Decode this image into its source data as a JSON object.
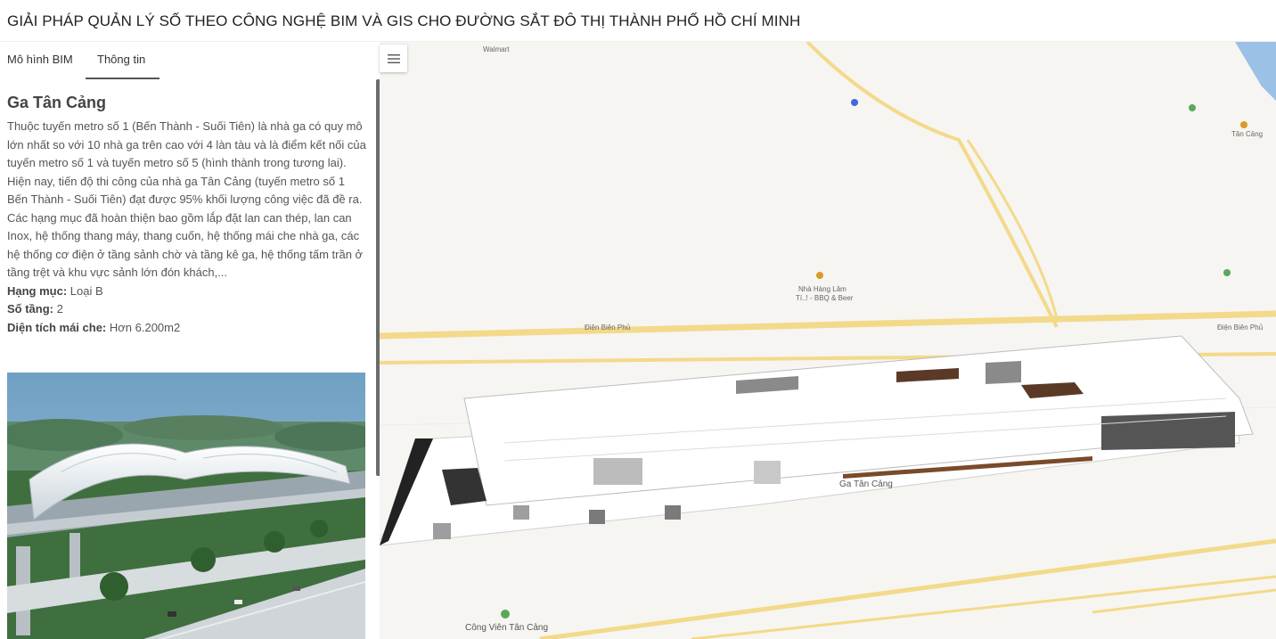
{
  "app": {
    "title": "GIẢI PHÁP QUẢN LÝ SỐ THEO CÔNG NGHỆ BIM VÀ GIS CHO ĐƯỜNG SẮT ĐÔ THỊ THÀNH PHỐ HỒ CHÍ MINH"
  },
  "tabs": [
    {
      "label": "Mô hình BIM",
      "active": false
    },
    {
      "label": "Thông tin",
      "active": true
    }
  ],
  "station": {
    "name": "Ga Tân Cảng",
    "description_1": "Thuộc tuyến metro số 1 (Bến Thành - Suối Tiên) là nhà ga có quy mô lớn nhất so với 10 nhà ga trên cao với 4 làn tàu và là điểm kết nối của tuyến metro số 1 và tuyến metro số 5 (hình thành trong tương lai).",
    "description_2": "Hiện nay, tiến độ thi công của nhà ga Tân Cảng (tuyến metro số 1 Bến Thành - Suối Tiên) đạt được 95% khối lượng công việc đã đề ra.",
    "description_3": "Các hạng mục đã hoàn thiện bao gồm lắp đặt lan can thép, lan can Inox, hệ thống thang máy, thang cuốn, hệ thống mái che nhà ga, các hệ thống cơ điện ở tầng sảnh chờ và tầng kê ga, hệ thống tấm trần ở tầng trệt và khu vực sảnh lớn đón khách,...",
    "category_label": "Hạng mục:",
    "category_value": "Loại B",
    "floors_label": "Số tầng:",
    "floors_value": "2",
    "roof_area_label": "Diện tích mái che:",
    "roof_area_value": "Hơn 6.200m2"
  },
  "map": {
    "menu_icon": "hamburger-menu-icon",
    "labels": {
      "walmart": "Walmart",
      "dien_bien_phu": "Điện Biên Phủ",
      "dien_bien_phu_2": "Điện Biên Phủ",
      "restaurant_line1": "Nhà Hàng Lâm",
      "restaurant_line2": "Tí..! - BBQ & Beer",
      "station": "Ga Tân Cảng",
      "park": "Công Viên Tân Cảng",
      "tan_cang_top": "Tân Cảng"
    }
  },
  "colors": {
    "road": "#f3d98a",
    "map_bg": "#f6f5f1",
    "water": "#9cc1e6",
    "poi_green": "#5aa85a"
  }
}
